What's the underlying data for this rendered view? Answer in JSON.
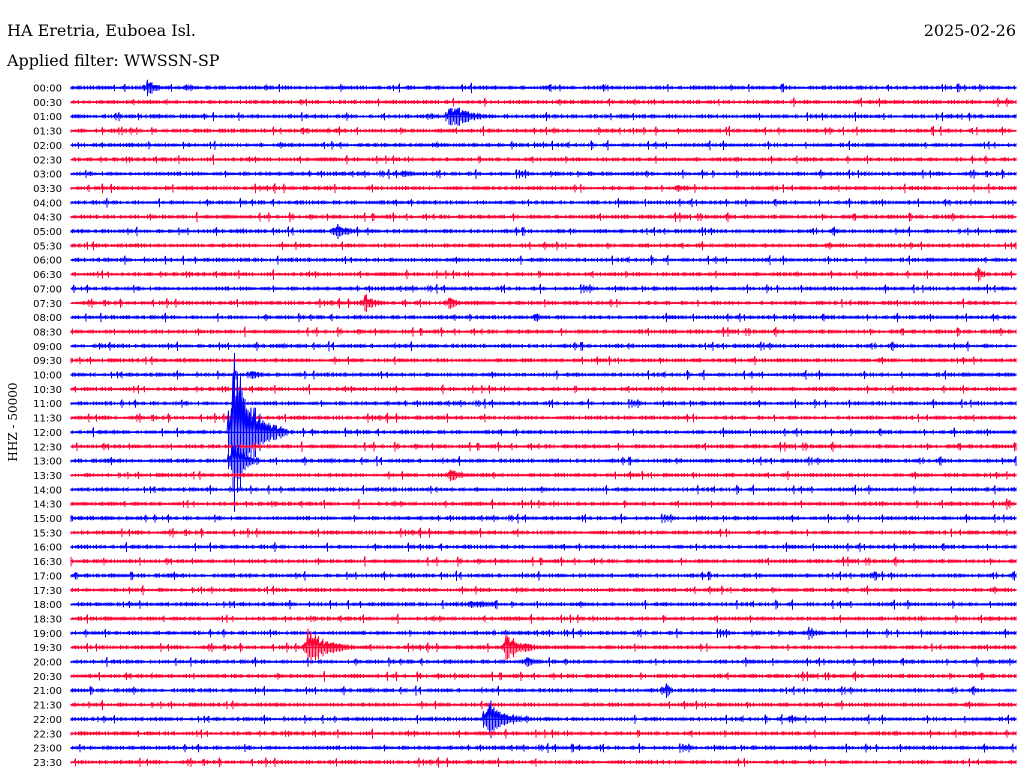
{
  "header": {
    "station": "HA Eretria, Euboea Isl.",
    "date": "2025-02-26",
    "filter": "Applied filter: WWSSN-SP"
  },
  "chart_data": {
    "type": "line",
    "subtype": "helicorder",
    "ylabel": "HHZ - 50000",
    "colors": [
      "#0000ff",
      "#ff0033"
    ],
    "rows": [
      "00:00",
      "00:30",
      "01:00",
      "01:30",
      "02:00",
      "02:30",
      "03:00",
      "03:30",
      "04:00",
      "04:30",
      "05:00",
      "05:30",
      "06:00",
      "06:30",
      "07:00",
      "07:30",
      "08:00",
      "08:30",
      "09:00",
      "09:30",
      "10:00",
      "10:30",
      "11:00",
      "11:30",
      "12:00",
      "12:30",
      "13:00",
      "13:30",
      "14:00",
      "14:30",
      "15:00",
      "15:30",
      "16:00",
      "16:30",
      "17:00",
      "17:30",
      "18:00",
      "18:30",
      "19:00",
      "19:30",
      "20:00",
      "20:30",
      "21:00",
      "21:30",
      "22:00",
      "22:30",
      "23:00",
      "23:30"
    ],
    "events": [
      {
        "row": 0,
        "x": 0.08,
        "amp": 10,
        "dur": 0.03
      },
      {
        "row": 0,
        "x": 0.12,
        "amp": 4,
        "dur": 0.04
      },
      {
        "row": 1,
        "x": 0.24,
        "amp": 3,
        "dur": 0.03
      },
      {
        "row": 2,
        "x": 0.4,
        "amp": 16,
        "dur": 0.06
      },
      {
        "row": 2,
        "x": 0.38,
        "amp": 3,
        "dur": 0.03
      },
      {
        "row": 6,
        "x": 0.35,
        "amp": 6,
        "dur": 0.03
      },
      {
        "row": 7,
        "x": 0.64,
        "amp": 6,
        "dur": 0.04
      },
      {
        "row": 10,
        "x": 0.28,
        "amp": 12,
        "dur": 0.03
      },
      {
        "row": 13,
        "x": 0.96,
        "amp": 8,
        "dur": 0.02
      },
      {
        "row": 15,
        "x": 0.31,
        "amp": 12,
        "dur": 0.03
      },
      {
        "row": 15,
        "x": 0.4,
        "amp": 10,
        "dur": 0.02
      },
      {
        "row": 16,
        "x": 0.49,
        "amp": 7,
        "dur": 0.02
      },
      {
        "row": 18,
        "x": 0.03,
        "amp": 4,
        "dur": 0.01
      },
      {
        "row": 19,
        "x": 0.12,
        "amp": 4,
        "dur": 0.01
      },
      {
        "row": 20,
        "x": 0.19,
        "amp": 7,
        "dur": 0.03
      },
      {
        "row": 24,
        "x": 0.17,
        "amp": 95,
        "dur": 0.06
      },
      {
        "row": 26,
        "x": 0.17,
        "amp": 40,
        "dur": 0.03
      },
      {
        "row": 27,
        "x": 0.4,
        "amp": 8,
        "dur": 0.04
      },
      {
        "row": 29,
        "x": 0.99,
        "amp": 7,
        "dur": 0.01
      },
      {
        "row": 30,
        "x": 0.0,
        "amp": 4,
        "dur": 0.02
      },
      {
        "row": 34,
        "x": 0.85,
        "amp": 8,
        "dur": 0.01
      },
      {
        "row": 35,
        "x": 0.47,
        "amp": 4,
        "dur": 0.03
      },
      {
        "row": 36,
        "x": 0.42,
        "amp": 5,
        "dur": 0.08
      },
      {
        "row": 38,
        "x": 0.78,
        "amp": 8,
        "dur": 0.03
      },
      {
        "row": 39,
        "x": 0.25,
        "amp": 22,
        "dur": 0.06
      },
      {
        "row": 39,
        "x": 0.46,
        "amp": 17,
        "dur": 0.05
      },
      {
        "row": 40,
        "x": 0.48,
        "amp": 6,
        "dur": 0.04
      },
      {
        "row": 42,
        "x": 0.63,
        "amp": 12,
        "dur": 0.01
      },
      {
        "row": 44,
        "x": 0.44,
        "amp": 28,
        "dur": 0.05
      },
      {
        "row": 44,
        "x": 0.76,
        "amp": 6,
        "dur": 0.03
      },
      {
        "row": 46,
        "x": 0.53,
        "amp": 5,
        "dur": 0.02
      }
    ]
  }
}
